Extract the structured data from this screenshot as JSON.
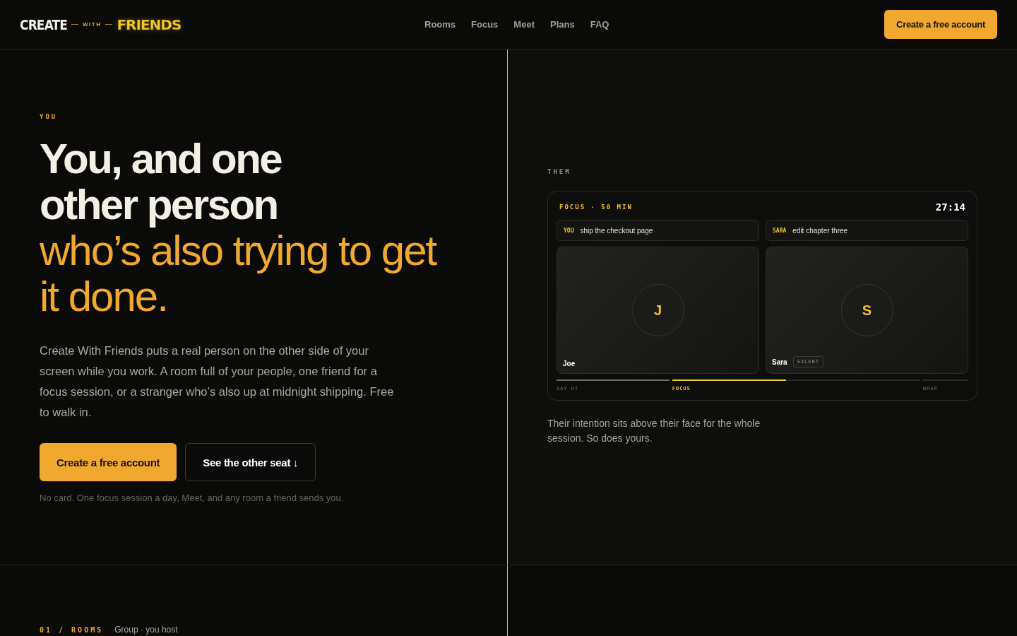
{
  "logo": {
    "first": "CREATE",
    "middle": "WITH",
    "last": "FRIENDS"
  },
  "nav": [
    "Rooms",
    "Focus",
    "Meet",
    "Plans",
    "FAQ"
  ],
  "header_button": "Create a free account",
  "hero": {
    "eyebrow": "YOU",
    "headline": {
      "lead": "You, and one other person",
      "accent": "who’s also trying to get it done."
    },
    "body": "Create With Friends puts a real person on the other side of your screen while you work. A room full of your people, one friend for a focus session, or a stranger who’s also up at midnight shipping. Free to walk in.",
    "primary_button": "Create a free account",
    "secondary_button": "See the other seat",
    "secondary_arrow": "↓",
    "note": "No card. One focus session a day, Meet, and any room a friend sends you."
  },
  "them": {
    "eyebrow": "THEM",
    "session": {
      "label": "FOCUS · 50 MIN",
      "timer": "27:14",
      "seats": [
        {
          "tag": "YOU",
          "intention": "ship the checkout page",
          "initial": "J",
          "name": "Joe"
        },
        {
          "tag": "SARA",
          "intention": "edit chapter three",
          "initial": "S",
          "name": "Sara",
          "badge": "SILENT"
        }
      ],
      "stages": [
        {
          "label": "SAY HI",
          "selected": false,
          "level": 1
        },
        {
          "label": "FOCUS",
          "selected": true,
          "level": 0.46
        },
        {
          "label": "WRAP",
          "selected": false
        }
      ]
    },
    "caption": "Their intention sits above their face for the whole session. So does yours."
  },
  "next_section": {
    "index": "01 / ROOMS",
    "subtitle": "Group · you host"
  }
}
